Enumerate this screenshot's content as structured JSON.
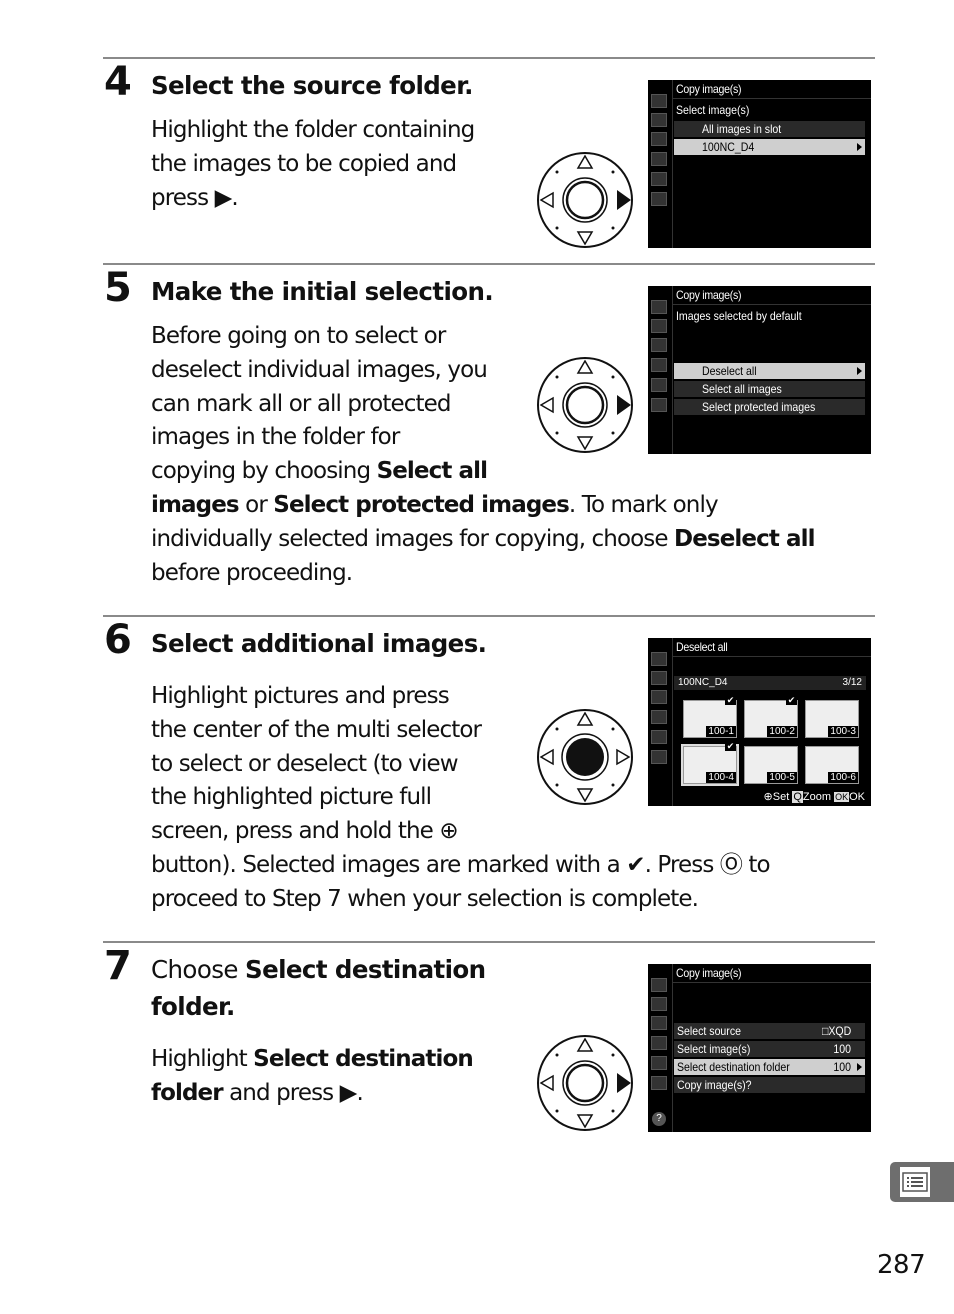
{
  "page_number": "287",
  "section_tab_icon": "menu-list-icon",
  "steps": [
    {
      "number": "4",
      "title": "Select the source folder.",
      "body_lines": [
        "Highlight the folder containing",
        "the images to be copied and",
        "press ▶."
      ],
      "multi_selector": "right-pressed",
      "screen": {
        "header": "Copy image(s)",
        "subheader": "Select image(s)",
        "rows": [
          {
            "label": "All images in slot",
            "selected": false
          },
          {
            "label": "100NC_D4",
            "selected": true
          }
        ]
      }
    },
    {
      "number": "5",
      "title": "Make the initial selection.",
      "body_lines": [
        "Before going on to select or",
        "deselect individual images, you",
        "can mark all or all protected",
        "images in the folder for"
      ],
      "body_line5_pre": "copying by choosing ",
      "body_line5_bold": "Select all",
      "body_line6_bold1": "images",
      "body_line6_mid": " or ",
      "body_line6_bold2": "Select protected images",
      "body_line6_post": ".  To mark only",
      "body_line7_pre": "individually selected images for copying, choose ",
      "body_line7_bold": "Deselect all",
      "body_line8": "before proceeding.",
      "multi_selector": "right-pressed",
      "screen": {
        "header": "Copy image(s)",
        "subheader": "Images selected by default",
        "rows": [
          {
            "label": "Deselect all",
            "selected": true
          },
          {
            "label": "Select all images",
            "selected": false
          },
          {
            "label": "Select protected images",
            "selected": false
          }
        ]
      }
    },
    {
      "number": "6",
      "title": "Select additional images.",
      "body_lines": [
        "Highlight pictures and press",
        "the center of the multi selector",
        "to select or deselect (to view",
        "the highlighted picture full",
        "screen, press and hold the ⊕"
      ],
      "body_line6": "button).  Selected images are marked with a ✔.  Press Ⓞ to",
      "body_line7": "proceed to Step 7 when your selection is complete.",
      "multi_selector": "center-pressed",
      "screen": {
        "header": "Deselect all",
        "folder": "100NC_D4",
        "counter": "3/12",
        "thumbnails": [
          {
            "label": "100-1",
            "checked": true,
            "current": false
          },
          {
            "label": "100-2",
            "checked": true,
            "current": false
          },
          {
            "label": "100-3",
            "checked": false,
            "current": false
          },
          {
            "label": "100-4",
            "checked": true,
            "current": true
          },
          {
            "label": "100-5",
            "checked": false,
            "current": false
          },
          {
            "label": "100-6",
            "checked": false,
            "current": false
          }
        ],
        "footer_set": "Set",
        "footer_zoom": "Zoom",
        "footer_ok_badge": "OK",
        "footer_ok": "OK"
      }
    },
    {
      "number": "7",
      "title_pre": "Choose ",
      "title_bold_line1": "Select destination",
      "title_bold_line2": "folder",
      "title_end": ".",
      "body_pre": "Highlight ",
      "body_bold1": "Select destination",
      "body_bold2": "folder",
      "body_post": " and press ▶.",
      "multi_selector": "right-pressed",
      "screen": {
        "header": "Copy image(s)",
        "rows": [
          {
            "label": "Select source",
            "value": "□XQD",
            "selected": false
          },
          {
            "label": "Select image(s)",
            "value": "100",
            "selected": false
          },
          {
            "label": "Select destination folder",
            "value": "100",
            "selected": true
          },
          {
            "label": "Copy image(s)?",
            "value": "",
            "selected": false
          }
        ],
        "help_icon": "?"
      }
    }
  ]
}
